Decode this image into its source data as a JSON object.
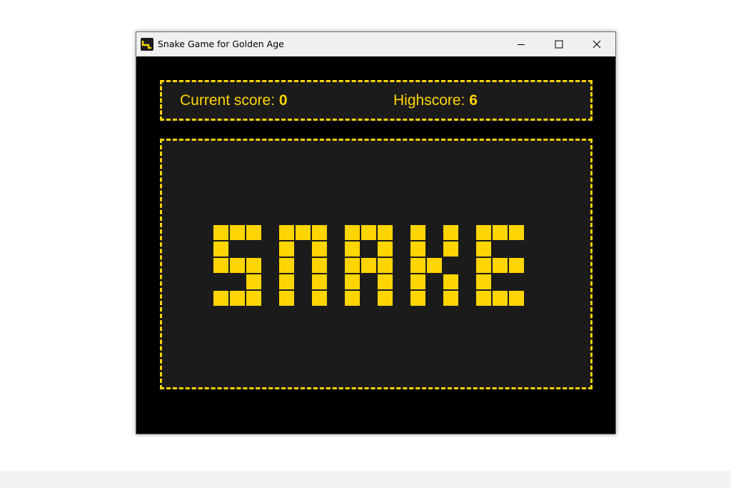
{
  "window": {
    "title": "Snake Game for Golden Age",
    "controls": [
      "minimize",
      "maximize",
      "close"
    ]
  },
  "scoreboard": {
    "current_label": "Current score:",
    "current_value": "0",
    "high_label": "Highscore:",
    "high_value": "6"
  },
  "game": {
    "logo_text": "SNAKE"
  },
  "colors": {
    "accent": "#ffd500",
    "panel": "#1b1b1b",
    "background": "#000000",
    "titlebar": "#f0f0f0"
  },
  "icons": {
    "app": "snake-app-icon",
    "minimize": "minimize-icon",
    "maximize": "maximize-icon",
    "close": "close-icon"
  }
}
